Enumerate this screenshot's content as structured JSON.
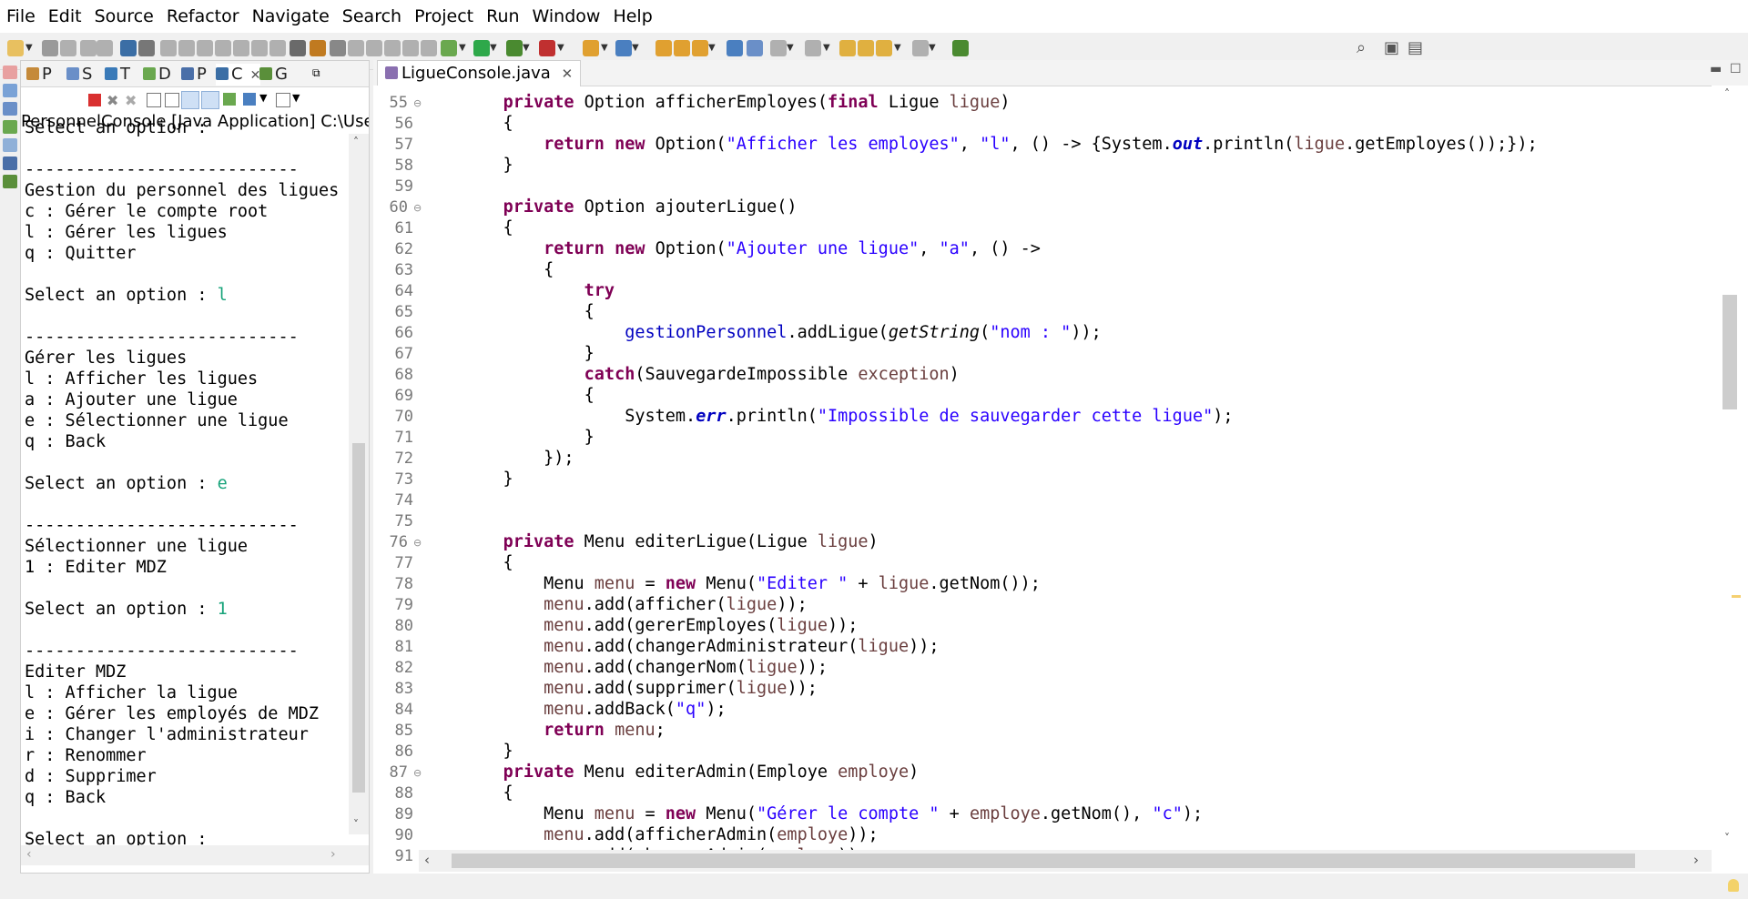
{
  "menu": [
    "File",
    "Edit",
    "Source",
    "Refactor",
    "Navigate",
    "Search",
    "Project",
    "Run",
    "Window",
    "Help"
  ],
  "left_tabs": [
    {
      "label": "P",
      "color": "#c58a3a"
    },
    {
      "label": "S",
      "color": "#6a8fc8"
    },
    {
      "label": "T",
      "color": "#3a7ab8"
    },
    {
      "label": "D",
      "color": "#6aa84f"
    },
    {
      "label": "P",
      "color": "#4a6fa8"
    },
    {
      "label": "C",
      "color": "#3b6ea5"
    },
    {
      "label": "G",
      "color": "#5a8f3a"
    }
  ],
  "console": {
    "label": "PersonnelConsole [Java Application] C:\\Users\\ste",
    "lines": [
      {
        "t": "Select an option : "
      },
      {
        "t": ""
      },
      {
        "t": "---------------------------"
      },
      {
        "t": "Gestion du personnel des ligues"
      },
      {
        "t": "c : Gérer le compte root"
      },
      {
        "t": "l : Gérer les ligues"
      },
      {
        "t": "q : Quitter"
      },
      {
        "t": ""
      },
      {
        "t": "Select an option : ",
        "input": "l"
      },
      {
        "t": ""
      },
      {
        "t": "---------------------------"
      },
      {
        "t": "Gérer les ligues"
      },
      {
        "t": "l : Afficher les ligues"
      },
      {
        "t": "a : Ajouter une ligue"
      },
      {
        "t": "e : Sélectionner une ligue"
      },
      {
        "t": "q : Back"
      },
      {
        "t": ""
      },
      {
        "t": "Select an option : ",
        "input": "e"
      },
      {
        "t": ""
      },
      {
        "t": "---------------------------"
      },
      {
        "t": "Sélectionner une ligue"
      },
      {
        "t": "1 : Editer MDZ"
      },
      {
        "t": ""
      },
      {
        "t": "Select an option : ",
        "input": "1"
      },
      {
        "t": ""
      },
      {
        "t": "---------------------------"
      },
      {
        "t": "Editer MDZ"
      },
      {
        "t": "l : Afficher la ligue"
      },
      {
        "t": "e : Gérer les employés de MDZ"
      },
      {
        "t": "i : Changer l'administrateur"
      },
      {
        "t": "r : Renommer"
      },
      {
        "t": "d : Supprimer"
      },
      {
        "t": "q : Back"
      },
      {
        "t": ""
      },
      {
        "t": "Select an option : "
      }
    ]
  },
  "editor": {
    "tab_title": "LigueConsole.java",
    "folds": [
      55,
      60,
      76,
      87
    ],
    "lines": [
      {
        "n": 55,
        "code": [
          [
            "    ",
            ""
          ],
          [
            "private",
            "kw"
          ],
          [
            " Option afficherEmployes(",
            ""
          ],
          [
            "final",
            "kw"
          ],
          [
            " Ligue ",
            ""
          ],
          [
            "ligue",
            "var"
          ],
          [
            ")",
            ""
          ]
        ]
      },
      {
        "n": 56,
        "code": [
          [
            "    {",
            ""
          ]
        ]
      },
      {
        "n": 57,
        "code": [
          [
            "        ",
            ""
          ],
          [
            "return",
            "kw"
          ],
          [
            " ",
            ""
          ],
          [
            "new",
            "kw"
          ],
          [
            " Option(",
            ""
          ],
          [
            "\"Afficher les employes\"",
            "str"
          ],
          [
            ", ",
            ""
          ],
          [
            "\"l\"",
            "str"
          ],
          [
            ", () -> {System.",
            ""
          ],
          [
            "out",
            "sfld"
          ],
          [
            ".println(",
            ""
          ],
          [
            "ligue",
            "var"
          ],
          [
            ".getEmployes());});",
            ""
          ]
        ]
      },
      {
        "n": 58,
        "code": [
          [
            "    }",
            ""
          ]
        ]
      },
      {
        "n": 59,
        "code": []
      },
      {
        "n": 60,
        "code": [
          [
            "    ",
            ""
          ],
          [
            "private",
            "kw"
          ],
          [
            " Option ajouterLigue()",
            ""
          ]
        ]
      },
      {
        "n": 61,
        "code": [
          [
            "    {",
            ""
          ]
        ]
      },
      {
        "n": 62,
        "code": [
          [
            "        ",
            ""
          ],
          [
            "return",
            "kw"
          ],
          [
            " ",
            ""
          ],
          [
            "new",
            "kw"
          ],
          [
            " Option(",
            ""
          ],
          [
            "\"Ajouter une ligue\"",
            "str"
          ],
          [
            ", ",
            ""
          ],
          [
            "\"a\"",
            "str"
          ],
          [
            ", () ->",
            ""
          ]
        ]
      },
      {
        "n": 63,
        "code": [
          [
            "        {",
            ""
          ]
        ]
      },
      {
        "n": 64,
        "code": [
          [
            "            ",
            ""
          ],
          [
            "try",
            "kw"
          ]
        ]
      },
      {
        "n": 65,
        "code": [
          [
            "            {",
            ""
          ]
        ]
      },
      {
        "n": 66,
        "code": [
          [
            "                ",
            ""
          ],
          [
            "gestionPersonnel",
            "fld"
          ],
          [
            ".addLigue(",
            ""
          ],
          [
            "getString",
            "ital"
          ],
          [
            "(",
            ""
          ],
          [
            "\"nom : \"",
            "str"
          ],
          [
            "));",
            ""
          ]
        ]
      },
      {
        "n": 67,
        "code": [
          [
            "            }",
            ""
          ]
        ]
      },
      {
        "n": 68,
        "code": [
          [
            "            ",
            ""
          ],
          [
            "catch",
            "kw"
          ],
          [
            "(SauvegardeImpossible ",
            ""
          ],
          [
            "exception",
            "var"
          ],
          [
            ")",
            ""
          ]
        ]
      },
      {
        "n": 69,
        "code": [
          [
            "            {",
            ""
          ]
        ]
      },
      {
        "n": 70,
        "code": [
          [
            "                System.",
            ""
          ],
          [
            "err",
            "sfld"
          ],
          [
            ".println(",
            ""
          ],
          [
            "\"Impossible de sauvegarder cette ligue\"",
            "str"
          ],
          [
            ");",
            ""
          ]
        ]
      },
      {
        "n": 71,
        "code": [
          [
            "            }",
            ""
          ]
        ]
      },
      {
        "n": 72,
        "code": [
          [
            "        });",
            ""
          ]
        ]
      },
      {
        "n": 73,
        "code": [
          [
            "    }",
            ""
          ]
        ]
      },
      {
        "n": 74,
        "code": []
      },
      {
        "n": 75,
        "code": []
      },
      {
        "n": 76,
        "code": [
          [
            "    ",
            ""
          ],
          [
            "private",
            "kw"
          ],
          [
            " Menu editerLigue(Ligue ",
            ""
          ],
          [
            "ligue",
            "var"
          ],
          [
            ")",
            ""
          ]
        ]
      },
      {
        "n": 77,
        "code": [
          [
            "    {",
            ""
          ]
        ]
      },
      {
        "n": 78,
        "code": [
          [
            "        Menu ",
            ""
          ],
          [
            "menu",
            "var"
          ],
          [
            " = ",
            ""
          ],
          [
            "new",
            "kw"
          ],
          [
            " Menu(",
            ""
          ],
          [
            "\"Editer \"",
            "str"
          ],
          [
            " + ",
            ""
          ],
          [
            "ligue",
            "var"
          ],
          [
            ".getNom());",
            ""
          ]
        ]
      },
      {
        "n": 79,
        "code": [
          [
            "        ",
            ""
          ],
          [
            "menu",
            "var"
          ],
          [
            ".add(afficher(",
            ""
          ],
          [
            "ligue",
            "var"
          ],
          [
            "));",
            ""
          ]
        ]
      },
      {
        "n": 80,
        "code": [
          [
            "        ",
            ""
          ],
          [
            "menu",
            "var"
          ],
          [
            ".add(gererEmployes(",
            ""
          ],
          [
            "ligue",
            "var"
          ],
          [
            "));",
            ""
          ]
        ]
      },
      {
        "n": 81,
        "code": [
          [
            "        ",
            ""
          ],
          [
            "menu",
            "var"
          ],
          [
            ".add(changerAdministrateur(",
            ""
          ],
          [
            "ligue",
            "var"
          ],
          [
            "));",
            ""
          ]
        ]
      },
      {
        "n": 82,
        "code": [
          [
            "        ",
            ""
          ],
          [
            "menu",
            "var"
          ],
          [
            ".add(changerNom(",
            ""
          ],
          [
            "ligue",
            "var"
          ],
          [
            "));",
            ""
          ]
        ]
      },
      {
        "n": 83,
        "code": [
          [
            "        ",
            ""
          ],
          [
            "menu",
            "var"
          ],
          [
            ".add(supprimer(",
            ""
          ],
          [
            "ligue",
            "var"
          ],
          [
            "));",
            ""
          ]
        ]
      },
      {
        "n": 84,
        "code": [
          [
            "        ",
            ""
          ],
          [
            "menu",
            "var"
          ],
          [
            ".addBack(",
            ""
          ],
          [
            "\"q\"",
            "str"
          ],
          [
            ");",
            ""
          ]
        ]
      },
      {
        "n": 85,
        "code": [
          [
            "        ",
            ""
          ],
          [
            "return",
            "kw"
          ],
          [
            " ",
            ""
          ],
          [
            "menu",
            "var"
          ],
          [
            ";",
            ""
          ]
        ]
      },
      {
        "n": 86,
        "code": [
          [
            "    }",
            ""
          ]
        ]
      },
      {
        "n": 87,
        "code": [
          [
            "    ",
            ""
          ],
          [
            "private",
            "kw"
          ],
          [
            " Menu editerAdmin(Employe ",
            ""
          ],
          [
            "employe",
            "var"
          ],
          [
            ")",
            ""
          ]
        ]
      },
      {
        "n": 88,
        "code": [
          [
            "    {",
            ""
          ]
        ]
      },
      {
        "n": 89,
        "code": [
          [
            "        Menu ",
            ""
          ],
          [
            "menu",
            "var"
          ],
          [
            " = ",
            ""
          ],
          [
            "new",
            "kw"
          ],
          [
            " Menu(",
            ""
          ],
          [
            "\"Gérer le compte \"",
            "str"
          ],
          [
            " + ",
            ""
          ],
          [
            "employe",
            "var"
          ],
          [
            ".getNom(), ",
            ""
          ],
          [
            "\"c\"",
            "str"
          ],
          [
            ");",
            ""
          ]
        ]
      },
      {
        "n": 90,
        "code": [
          [
            "        ",
            ""
          ],
          [
            "menu",
            "var"
          ],
          [
            ".add(afficherAdmin(",
            ""
          ],
          [
            "employe",
            "var"
          ],
          [
            "));",
            ""
          ]
        ]
      },
      {
        "n": 91,
        "code": [
          [
            "        ",
            ""
          ],
          [
            "menu",
            "var"
          ],
          [
            ".add(changerAdmin(",
            ""
          ],
          [
            "employe",
            "var"
          ],
          [
            "));",
            ""
          ]
        ]
      }
    ]
  },
  "colors": {
    "keyword": "#7f0055",
    "string": "#2a00ff",
    "field": "#0000c0",
    "local": "#6a3e3e",
    "console_input": "#17a37a",
    "line_number": "#787878"
  }
}
